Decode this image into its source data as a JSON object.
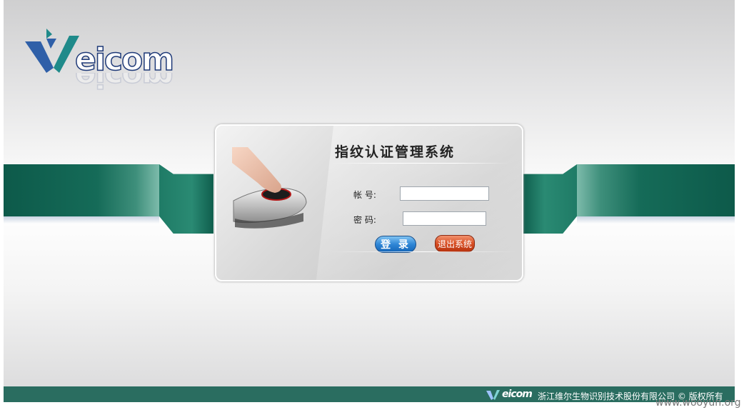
{
  "brand": {
    "logo_text": "eicom",
    "logo_colors": {
      "v_left": "#2f5fa8",
      "v_right": "#1f8a8a",
      "text": "#1f3a78"
    }
  },
  "login": {
    "title": "指纹认证管理系统",
    "account_label": "帐 号:",
    "account_value": "",
    "password_label": "密 码:",
    "password_value": "",
    "login_button": "登 录",
    "exit_button": "退出系统"
  },
  "footer": {
    "logo_text": "eicom",
    "copyright": "浙江维尔生物识别技术股份有限公司 © 版权所有"
  },
  "watermark": "www.wooyun.org",
  "colors": {
    "band_green": "#0d5a4a",
    "footer_green": "#2a6d60",
    "login_blue": "#2f86d6",
    "exit_red": "#d74e23"
  }
}
